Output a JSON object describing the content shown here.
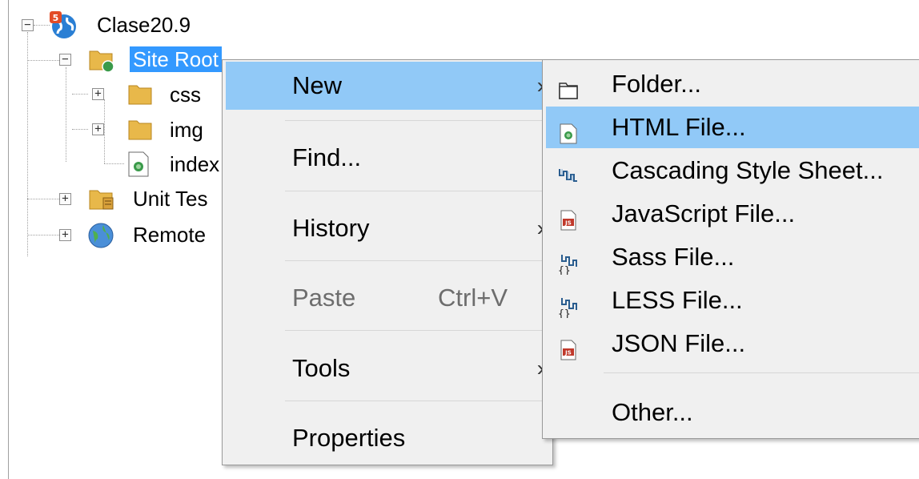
{
  "tree": {
    "root": {
      "label": "Clase20.9",
      "icon": "html5-globe-icon"
    },
    "nodes": [
      {
        "label": "Site Root",
        "icon": "folder-globe-icon"
      },
      {
        "label": "css",
        "icon": "folder-icon"
      },
      {
        "label": "img",
        "icon": "folder-icon"
      },
      {
        "label": "index",
        "icon": "html-file-icon"
      },
      {
        "label": "Unit Tes",
        "icon": "folder-test-icon"
      },
      {
        "label": "Remote",
        "icon": "globe-icon"
      }
    ]
  },
  "context_menu": {
    "items": [
      {
        "label": "New",
        "shortcut": "",
        "submenu_arrow": "›",
        "active": true
      },
      {
        "label": "Find...",
        "shortcut": ""
      },
      {
        "label": "History",
        "shortcut": "",
        "submenu_arrow": "›"
      },
      {
        "label": "Paste",
        "shortcut": "Ctrl+V",
        "disabled": true
      },
      {
        "label": "Tools",
        "shortcut": "",
        "submenu_arrow": "›"
      },
      {
        "label": "Properties",
        "shortcut": ""
      }
    ]
  },
  "new_submenu": {
    "items": [
      {
        "label": "Folder...",
        "icon": "folder-icon"
      },
      {
        "label": "HTML File...",
        "icon": "html-file-icon",
        "active": true
      },
      {
        "label": "Cascading Style Sheet...",
        "icon": "css-icon"
      },
      {
        "label": "JavaScript File...",
        "icon": "js-file-icon"
      },
      {
        "label": "Sass File...",
        "icon": "sass-icon"
      },
      {
        "label": "LESS File...",
        "icon": "less-icon"
      },
      {
        "label": "JSON File...",
        "icon": "json-file-icon"
      },
      {
        "label": "Other...",
        "icon": ""
      }
    ]
  },
  "colors": {
    "selection": "#3399ff",
    "menu_highlight": "#91c9f7",
    "menu_bg": "#f0f0f0"
  }
}
